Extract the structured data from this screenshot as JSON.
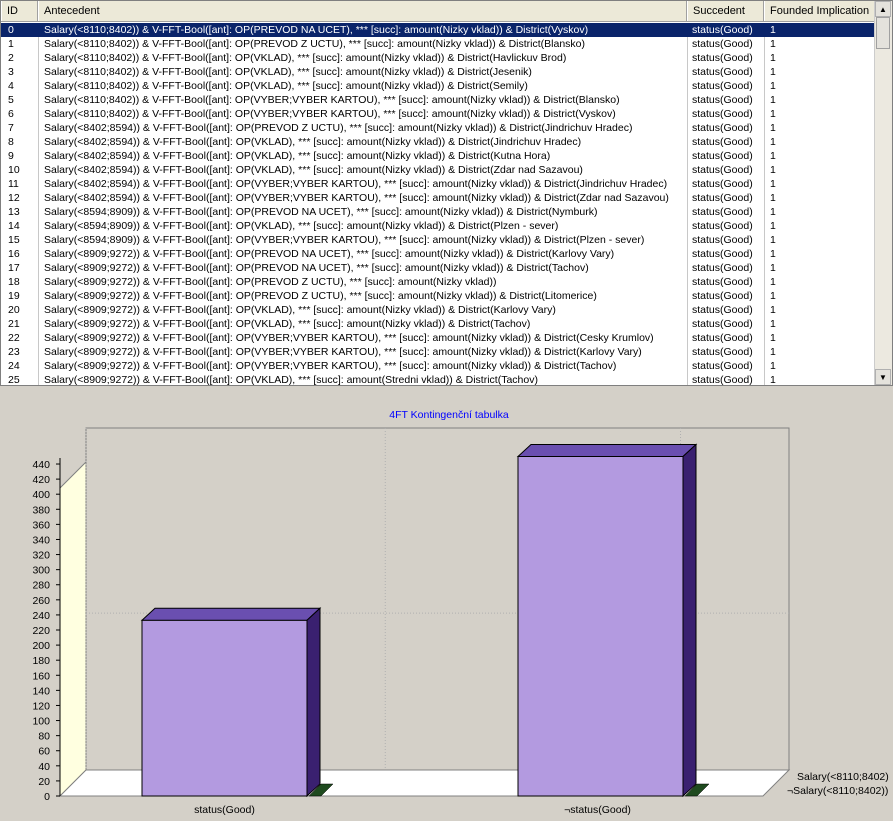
{
  "grid": {
    "columns": {
      "id": "ID",
      "antecedent": "Antecedent",
      "succedent": "Succedent",
      "implication": "Founded Implication"
    },
    "rows": [
      {
        "id": "0",
        "antecedent": "Salary(<8110;8402)) & V-FFT-Bool([ant]: OP(PREVOD NA UCET),  *** [succ]: amount(Nizky vklad)) & District(Vyskov)",
        "succedent": "status(Good)",
        "implication": "1",
        "selected": true
      },
      {
        "id": "1",
        "antecedent": "Salary(<8110;8402)) & V-FFT-Bool([ant]: OP(PREVOD Z UCTU),  *** [succ]: amount(Nizky vklad)) & District(Blansko)",
        "succedent": "status(Good)",
        "implication": "1"
      },
      {
        "id": "2",
        "antecedent": "Salary(<8110;8402)) & V-FFT-Bool([ant]: OP(VKLAD),  *** [succ]: amount(Nizky vklad)) & District(Havlickuv Brod)",
        "succedent": "status(Good)",
        "implication": "1"
      },
      {
        "id": "3",
        "antecedent": "Salary(<8110;8402)) & V-FFT-Bool([ant]: OP(VKLAD),  *** [succ]: amount(Nizky vklad)) & District(Jesenik)",
        "succedent": "status(Good)",
        "implication": "1"
      },
      {
        "id": "4",
        "antecedent": "Salary(<8110;8402)) & V-FFT-Bool([ant]: OP(VKLAD),  *** [succ]: amount(Nizky vklad)) & District(Semily)",
        "succedent": "status(Good)",
        "implication": "1"
      },
      {
        "id": "5",
        "antecedent": "Salary(<8110;8402)) & V-FFT-Bool([ant]: OP(VYBER;VYBER KARTOU),  *** [succ]: amount(Nizky vklad)) & District(Blansko)",
        "succedent": "status(Good)",
        "implication": "1"
      },
      {
        "id": "6",
        "antecedent": "Salary(<8110;8402)) & V-FFT-Bool([ant]: OP(VYBER;VYBER KARTOU),  *** [succ]: amount(Nizky vklad)) & District(Vyskov)",
        "succedent": "status(Good)",
        "implication": "1"
      },
      {
        "id": "7",
        "antecedent": "Salary(<8402;8594)) & V-FFT-Bool([ant]: OP(PREVOD Z UCTU),  *** [succ]: amount(Nizky vklad)) & District(Jindrichuv Hradec)",
        "succedent": "status(Good)",
        "implication": "1"
      },
      {
        "id": "8",
        "antecedent": "Salary(<8402;8594)) & V-FFT-Bool([ant]: OP(VKLAD),  *** [succ]: amount(Nizky vklad)) & District(Jindrichuv Hradec)",
        "succedent": "status(Good)",
        "implication": "1"
      },
      {
        "id": "9",
        "antecedent": "Salary(<8402;8594)) & V-FFT-Bool([ant]: OP(VKLAD),  *** [succ]: amount(Nizky vklad)) & District(Kutna Hora)",
        "succedent": "status(Good)",
        "implication": "1"
      },
      {
        "id": "10",
        "antecedent": "Salary(<8402;8594)) & V-FFT-Bool([ant]: OP(VKLAD),  *** [succ]: amount(Nizky vklad)) & District(Zdar nad Sazavou)",
        "succedent": "status(Good)",
        "implication": "1"
      },
      {
        "id": "11",
        "antecedent": "Salary(<8402;8594)) & V-FFT-Bool([ant]: OP(VYBER;VYBER KARTOU),  *** [succ]: amount(Nizky vklad)) & District(Jindrichuv Hradec)",
        "succedent": "status(Good)",
        "implication": "1"
      },
      {
        "id": "12",
        "antecedent": "Salary(<8402;8594)) & V-FFT-Bool([ant]: OP(VYBER;VYBER KARTOU),  *** [succ]: amount(Nizky vklad)) & District(Zdar nad Sazavou)",
        "succedent": "status(Good)",
        "implication": "1"
      },
      {
        "id": "13",
        "antecedent": "Salary(<8594;8909)) & V-FFT-Bool([ant]: OP(PREVOD NA UCET),  *** [succ]: amount(Nizky vklad)) & District(Nymburk)",
        "succedent": "status(Good)",
        "implication": "1"
      },
      {
        "id": "14",
        "antecedent": "Salary(<8594;8909)) & V-FFT-Bool([ant]: OP(VKLAD),  *** [succ]: amount(Nizky vklad)) & District(Plzen - sever)",
        "succedent": "status(Good)",
        "implication": "1"
      },
      {
        "id": "15",
        "antecedent": "Salary(<8594;8909)) & V-FFT-Bool([ant]: OP(VYBER;VYBER KARTOU),  *** [succ]: amount(Nizky vklad)) & District(Plzen - sever)",
        "succedent": "status(Good)",
        "implication": "1"
      },
      {
        "id": "16",
        "antecedent": "Salary(<8909;9272)) & V-FFT-Bool([ant]: OP(PREVOD NA UCET),  *** [succ]: amount(Nizky vklad)) & District(Karlovy Vary)",
        "succedent": "status(Good)",
        "implication": "1"
      },
      {
        "id": "17",
        "antecedent": "Salary(<8909;9272)) & V-FFT-Bool([ant]: OP(PREVOD NA UCET),  *** [succ]: amount(Nizky vklad)) & District(Tachov)",
        "succedent": "status(Good)",
        "implication": "1"
      },
      {
        "id": "18",
        "antecedent": "Salary(<8909;9272)) & V-FFT-Bool([ant]: OP(PREVOD Z UCTU),  *** [succ]: amount(Nizky vklad))",
        "succedent": "status(Good)",
        "implication": "1"
      },
      {
        "id": "19",
        "antecedent": "Salary(<8909;9272)) & V-FFT-Bool([ant]: OP(PREVOD Z UCTU),  *** [succ]: amount(Nizky vklad)) & District(Litomerice)",
        "succedent": "status(Good)",
        "implication": "1"
      },
      {
        "id": "20",
        "antecedent": "Salary(<8909;9272)) & V-FFT-Bool([ant]: OP(VKLAD),  *** [succ]: amount(Nizky vklad)) & District(Karlovy Vary)",
        "succedent": "status(Good)",
        "implication": "1"
      },
      {
        "id": "21",
        "antecedent": "Salary(<8909;9272)) & V-FFT-Bool([ant]: OP(VKLAD),  *** [succ]: amount(Nizky vklad)) & District(Tachov)",
        "succedent": "status(Good)",
        "implication": "1"
      },
      {
        "id": "22",
        "antecedent": "Salary(<8909;9272)) & V-FFT-Bool([ant]: OP(VYBER;VYBER KARTOU),  *** [succ]: amount(Nizky vklad)) & District(Cesky Krumlov)",
        "succedent": "status(Good)",
        "implication": "1"
      },
      {
        "id": "23",
        "antecedent": "Salary(<8909;9272)) & V-FFT-Bool([ant]: OP(VYBER;VYBER KARTOU),  *** [succ]: amount(Nizky vklad)) & District(Karlovy Vary)",
        "succedent": "status(Good)",
        "implication": "1"
      },
      {
        "id": "24",
        "antecedent": "Salary(<8909;9272)) & V-FFT-Bool([ant]: OP(VYBER;VYBER KARTOU),  *** [succ]: amount(Nizky vklad)) & District(Tachov)",
        "succedent": "status(Good)",
        "implication": "1"
      },
      {
        "id": "25",
        "antecedent": "Salary(<8909;9272)) & V-FFT-Bool([ant]: OP(VKLAD),  *** [succ]: amount(Stredni vklad)) & District(Tachov)",
        "succedent": "status(Good)",
        "implication": "1"
      }
    ],
    "scroll_up_icon": "scroll-up-arrow",
    "scroll_down_icon": "scroll-down-arrow"
  },
  "chart_data": {
    "type": "bar",
    "title": "4FT Kontingenční tabulka",
    "categories": [
      "status(Good)",
      "¬status(Good)"
    ],
    "series": [
      {
        "name": "Salary(<8110;8402)",
        "values": [
          233,
          450
        ],
        "color": "#b39ae0"
      },
      {
        "name": "¬Salary(<8110;8402))",
        "values": [
          0,
          0
        ],
        "color": "#1e4a1e"
      }
    ],
    "yticks": [
      0,
      20,
      40,
      60,
      80,
      100,
      120,
      140,
      160,
      180,
      200,
      220,
      240,
      260,
      280,
      300,
      320,
      340,
      360,
      380,
      400,
      420,
      440
    ],
    "ylim": [
      0,
      460
    ],
    "grid": true,
    "legend": "right",
    "title_color": "#0000ff"
  }
}
